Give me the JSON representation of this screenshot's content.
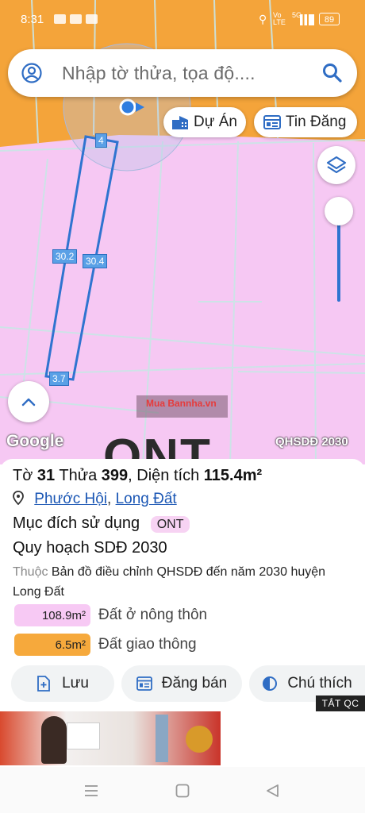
{
  "status_bar": {
    "time": "8:31",
    "network": "Vo LTE",
    "signal_label": "5G",
    "battery": "89"
  },
  "search": {
    "placeholder": "Nhập tờ thửa, tọa độ...."
  },
  "map": {
    "chip_project": "Dự Án",
    "chip_listing": "Tin Đăng",
    "segment_labels": [
      "4",
      "30.2",
      "30.4",
      "3.7"
    ],
    "zone_code": "ONT",
    "attribution": "Google",
    "layer_name": "QHSDĐ 2030",
    "watermark": "Mua Bannha.vn",
    "colors": {
      "residential_pink": "#f6c8f3",
      "road_orange": "#f4a43a",
      "parcel_blue": "#2f74d0"
    }
  },
  "panel": {
    "to_label": "Tờ",
    "to_value": "31",
    "thua_label": "Thửa",
    "thua_value": "399",
    "area_label": ", Diện tích",
    "area_value": "115.4m²",
    "location_ward": "Phước Hội",
    "location_sep": ",",
    "location_district": "Long Đất",
    "purpose_label": "Mục đích sử dụng",
    "purpose_badge": "ONT",
    "plan_title": "Quy hoạch SDĐ 2030",
    "belongs_prefix": "Thuộc",
    "belongs_text": "Bản đồ điều chỉnh QHSDĐ đến năm 2030 huyện Long Đất",
    "legend": [
      {
        "value": "108.9m²",
        "label": "Đất ở nông thôn",
        "color": "#f7c9f4"
      },
      {
        "value": "6.5m²",
        "label": "Đất giao thông",
        "color": "#f6a93c"
      }
    ],
    "actions": {
      "save": "Lưu",
      "post": "Đăng bán",
      "notes": "Chú thích"
    }
  },
  "ad": {
    "close_label": "TẮT QC"
  },
  "icons": [
    "person-circle-icon",
    "search-icon",
    "building-icon",
    "listing-icon",
    "layers-icon",
    "chevron-up-icon",
    "location-pin-icon",
    "add-doc-icon",
    "listing-icon",
    "half-circle-icon",
    "menu-icon",
    "home-square-icon",
    "back-triangle-icon"
  ]
}
